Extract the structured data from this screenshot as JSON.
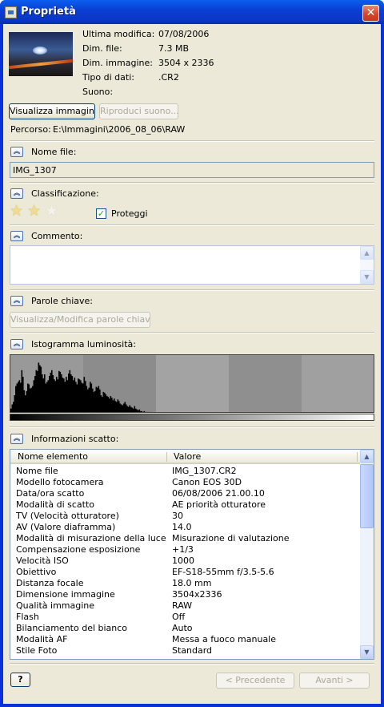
{
  "window": {
    "title": "Proprietà",
    "close_glyph": "✕"
  },
  "file_info": {
    "labels": {
      "modified": "Ultima modifica:",
      "file_size": "Dim. file:",
      "image_size": "Dim. immagine:",
      "data_type": "Tipo di dati:",
      "sound": "Suono:"
    },
    "values": {
      "modified": "07/08/2006",
      "file_size": "7.3 MB",
      "image_size": "3504 x 2336",
      "data_type": ".CR2",
      "sound": ""
    }
  },
  "buttons": {
    "view_image": "Visualizza immagine...",
    "play_sound": "Riproduci suono...",
    "view_keywords": "Visualizza/Modifica parole chiave ...",
    "help": "?",
    "previous": "< Precedente",
    "next": "Avanti >"
  },
  "path": {
    "label": "Percorso:",
    "value": "E:\\Immagini\\2006_08_06\\RAW"
  },
  "sections": {
    "file_name": "Nome file:",
    "rating": "Classificazione:",
    "comment": "Commento:",
    "keywords": "Parole chiave:",
    "histogram": "Istogramma luminosità:",
    "shot_info": "Informazioni scatto:"
  },
  "file_name_value": "IMG_1307",
  "comment_value": "",
  "rating": {
    "stars": 2,
    "max": 5,
    "protect_label": "Proteggi",
    "protect_checked": true
  },
  "histogram": {
    "bins": [
      6,
      11,
      14,
      22,
      33,
      36,
      38,
      40,
      37,
      52,
      44,
      28,
      22,
      27,
      36,
      35,
      30,
      31,
      33,
      40,
      45,
      52,
      51,
      61,
      58,
      56,
      47,
      42,
      47,
      36,
      38,
      40,
      45,
      49,
      52,
      46,
      41,
      39,
      44,
      41,
      51,
      50,
      47,
      43,
      42,
      38,
      44,
      40,
      48,
      52,
      47,
      45,
      40,
      43,
      38,
      35,
      42,
      41,
      40,
      37,
      36,
      44,
      39,
      33,
      29,
      31,
      38,
      36,
      30,
      26,
      27,
      32,
      31,
      33,
      29,
      22,
      20,
      26,
      25,
      23,
      21,
      20,
      18,
      21,
      19,
      16,
      18,
      15,
      14,
      17,
      15,
      12,
      11,
      10,
      12,
      14,
      11,
      9,
      8,
      10,
      8,
      7,
      6,
      9,
      6,
      5,
      4,
      5,
      3,
      3,
      2,
      3,
      2,
      2,
      2,
      2,
      1,
      2,
      1,
      1,
      1,
      1,
      1,
      1,
      1,
      1,
      1,
      1,
      1,
      1,
      1,
      1,
      1,
      1,
      1,
      1,
      1,
      0,
      0,
      0,
      0,
      0,
      0,
      0,
      0,
      0
    ],
    "band_shades": [
      "#999999",
      "#8c8c8c",
      "#a3a3a3",
      "#8f8f8f",
      "#a0a0a0"
    ]
  },
  "shot_table": {
    "headers": [
      "Nome elemento",
      "Valore"
    ],
    "rows": [
      [
        "Nome file",
        "IMG_1307.CR2"
      ],
      [
        "Modello fotocamera",
        "Canon EOS 30D"
      ],
      [
        "Data/ora scatto",
        "06/08/2006 21.00.10"
      ],
      [
        "Modalità di scatto",
        "AE priorità otturatore"
      ],
      [
        "TV (Velocità otturatore)",
        "30"
      ],
      [
        "AV (Valore diaframma)",
        "14.0"
      ],
      [
        "Modalità di misurazione della luce",
        "Misurazione di valutazione"
      ],
      [
        "Compensazione esposizione",
        "+1/3"
      ],
      [
        "Velocità ISO",
        "1000"
      ],
      [
        "Obiettivo",
        "EF-S18-55mm f/3.5-5.6"
      ],
      [
        "Distanza focale",
        "18.0 mm"
      ],
      [
        "Dimensione immagine",
        "3504x2336"
      ],
      [
        "Qualità immagine",
        "RAW"
      ],
      [
        "Flash",
        "Off"
      ],
      [
        "Bilanciamento del bianco",
        "Auto"
      ],
      [
        "Modalità AF",
        "Messa a fuoco manuale"
      ],
      [
        "Stile Foto",
        "Standard"
      ]
    ]
  },
  "icons": {
    "collapse": "chevron-up-double-icon",
    "star": "star-icon"
  }
}
